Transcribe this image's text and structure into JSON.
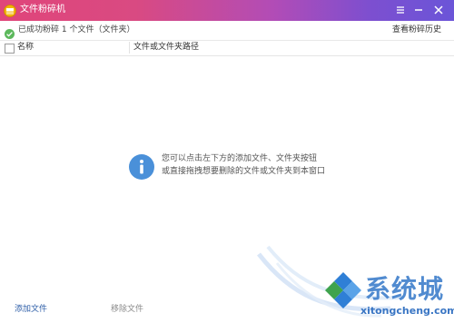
{
  "titlebar": {
    "title": "文件粉碎机",
    "app_icon": "shredder-app-icon",
    "buttons": [
      "menu-icon",
      "minimize-icon",
      "close-icon"
    ]
  },
  "status": {
    "icon": "check-circle-icon",
    "text": "已成功粉碎 1 个文件（文件夹）",
    "history_link": "查看粉碎历史"
  },
  "table": {
    "columns": [
      "名称",
      "文件或文件夹路径"
    ],
    "rows": []
  },
  "empty_hint": {
    "icon": "info-icon",
    "line1": "您可以点击左下方的添加文件、文件夹按钮",
    "line2": "或直接拖拽想要删除的文件或文件夹到本窗口"
  },
  "footer": {
    "add_file": "添加文件",
    "remove_file": "移除文件"
  },
  "watermark": {
    "text_cn": "系统城",
    "text_en": "xitongcheng.com"
  },
  "colors": {
    "title_gradient_start": "#e0457a",
    "title_gradient_end": "#6b55d8",
    "success_green": "#5cb85c",
    "info_blue": "#4a90d9",
    "link_blue": "#2f5fa8"
  }
}
